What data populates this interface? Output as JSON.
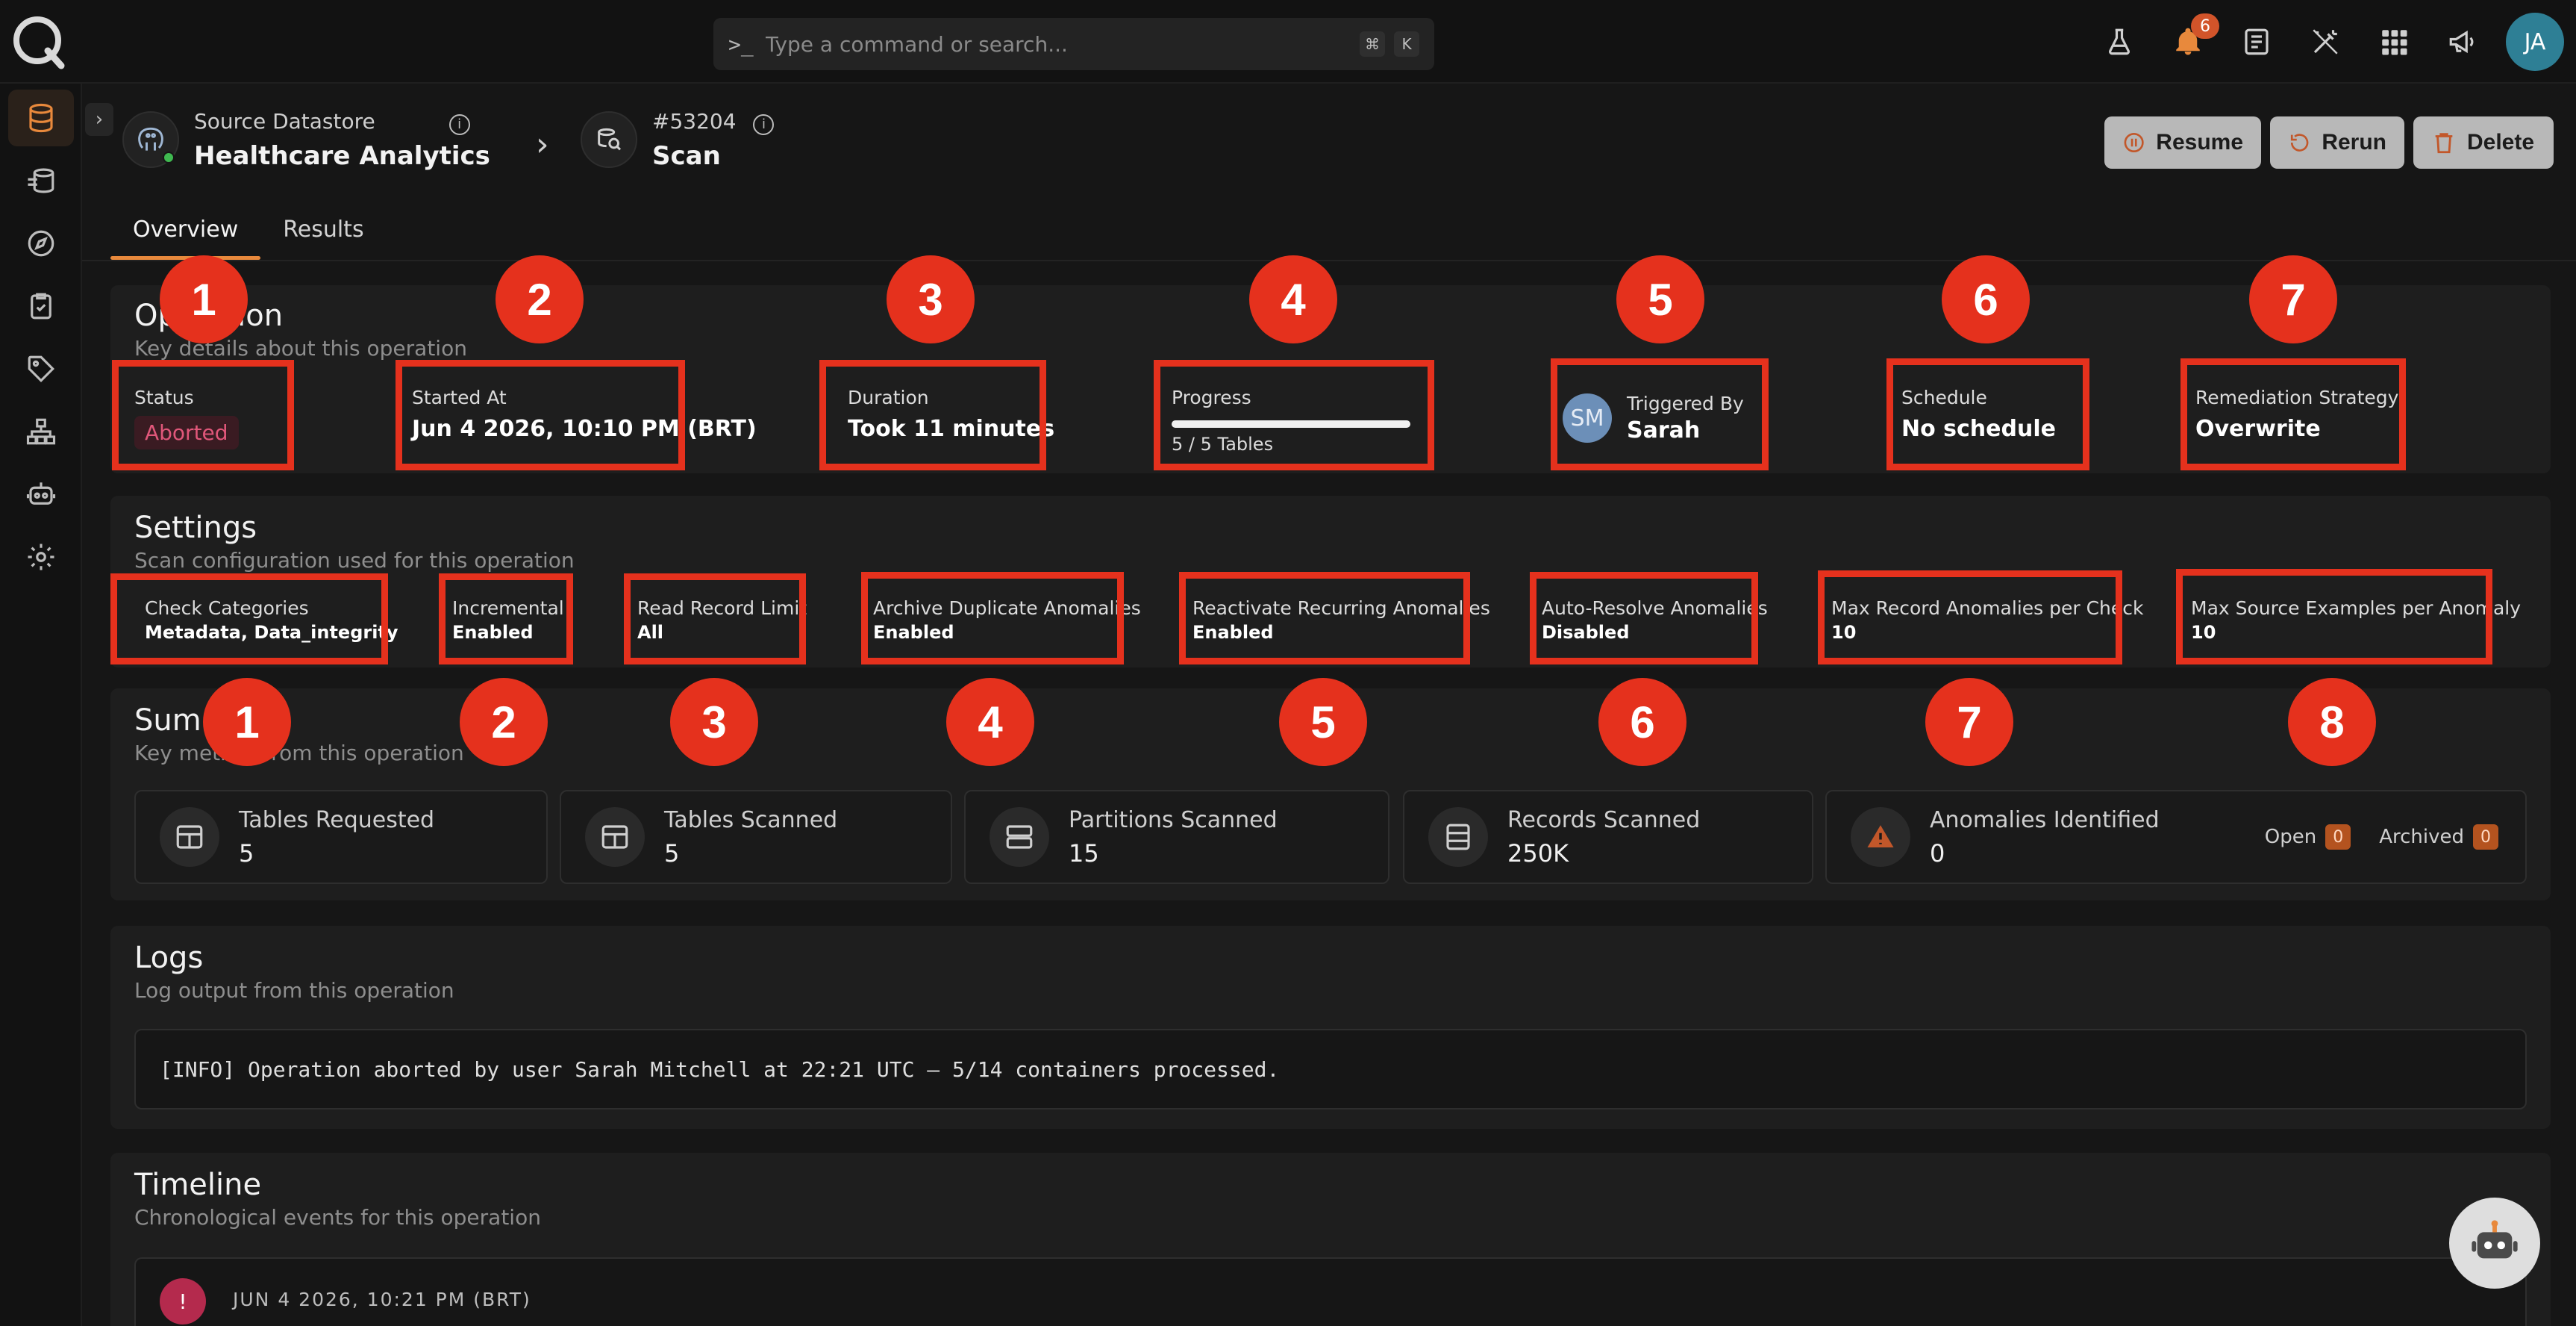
{
  "search": {
    "placeholder": "Type a command or search...",
    "kbd1": "⌘",
    "kbd2": "K"
  },
  "topbar": {
    "notifications_count": "6",
    "user_initials": "JA"
  },
  "header": {
    "datastore_label": "Source Datastore",
    "datastore_name": "Healthcare Analytics",
    "operation_id": "#53204",
    "operation_type": "Scan",
    "info": "i",
    "chevron": "›"
  },
  "actions": {
    "resume": "Resume",
    "rerun": "Rerun",
    "delete": "Delete"
  },
  "tabs": [
    {
      "label": "Overview"
    },
    {
      "label": "Results"
    }
  ],
  "operation": {
    "title": "Operation",
    "subtitle": "Key details about this operation",
    "status_label": "Status",
    "status_value": "Aborted",
    "started_label": "Started At",
    "started_value": "Jun 4 2026, 10:10 PM (BRT)",
    "duration_label": "Duration",
    "duration_value": "Took 11 minutes",
    "progress_label": "Progress",
    "progress_value": "5 / 5 Tables",
    "progress_fraction": 1.0,
    "triggered_label": "Triggered By",
    "triggered_value": "Sarah",
    "triggered_initials": "SM",
    "schedule_label": "Schedule",
    "schedule_value": "No schedule",
    "remediation_label": "Remediation Strategy",
    "remediation_value": "Overwrite"
  },
  "settings": {
    "title": "Settings",
    "subtitle": "Scan configuration used for this operation",
    "items": [
      {
        "label": "Check Categories",
        "value": "Metadata, Data_integrity"
      },
      {
        "label": "Incremental",
        "value": "Enabled"
      },
      {
        "label": "Read Record Limit",
        "value": "All"
      },
      {
        "label": "Archive Duplicate Anomalies",
        "value": "Enabled"
      },
      {
        "label": "Reactivate Recurring Anomalies",
        "value": "Enabled"
      },
      {
        "label": "Auto-Resolve Anomalies",
        "value": "Disabled"
      },
      {
        "label": "Max Record Anomalies per Check",
        "value": "10"
      },
      {
        "label": "Max Source Examples per Anomaly",
        "value": "10"
      }
    ]
  },
  "markers": {
    "operation": [
      "1",
      "2",
      "3",
      "4",
      "5",
      "6",
      "7"
    ],
    "settings": [
      "1",
      "2",
      "3",
      "4",
      "5",
      "6",
      "7",
      "8"
    ]
  },
  "summary": {
    "title": "Summary",
    "subtitle": "Key metrics from this operation",
    "metrics": [
      {
        "label": "Tables Requested",
        "value": "5"
      },
      {
        "label": "Tables Scanned",
        "value": "5"
      },
      {
        "label": "Partitions Scanned",
        "value": "15"
      },
      {
        "label": "Records Scanned",
        "value": "250K"
      },
      {
        "label": "Anomalies Identified",
        "value": "0"
      }
    ],
    "open_label": "Open",
    "open_count": "0",
    "archived_label": "Archived",
    "archived_count": "0"
  },
  "logs": {
    "title": "Logs",
    "subtitle": "Log output from this operation",
    "line": "[INFO] Operation aborted by user Sarah Mitchell at 22:21 UTC — 5/14 containers processed."
  },
  "timeline": {
    "title": "Timeline",
    "subtitle": "Chronological events for this operation",
    "first_date": "JUN 4 2026, 10:21 PM (BRT)",
    "first_icon": "!"
  },
  "colors": {
    "accent": "#e8893c",
    "annotation": "#e5311d",
    "aborted": "#e0577a"
  }
}
